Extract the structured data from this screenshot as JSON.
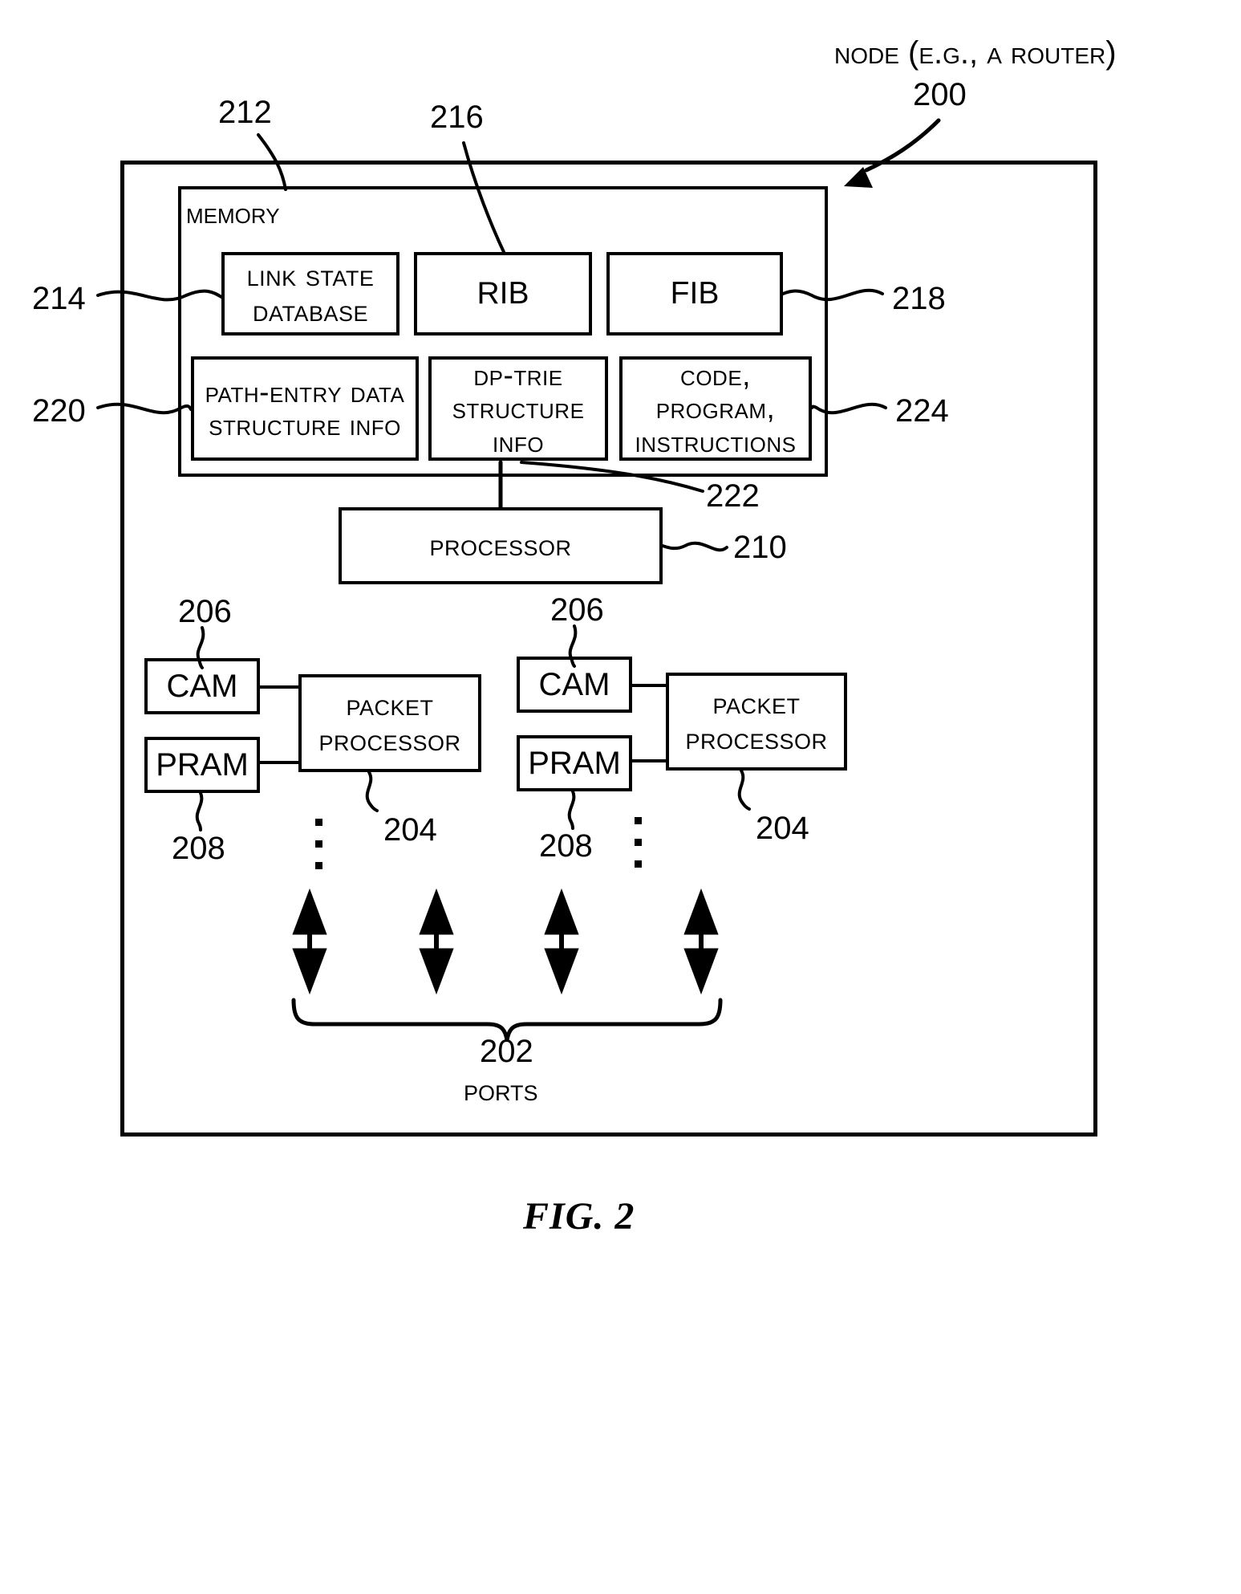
{
  "figure": {
    "label": "FIG. 2",
    "node_title": "Node (e.g., a Router)",
    "node_ref": "200"
  },
  "memory": {
    "label": "Memory",
    "ref": "212",
    "items": [
      {
        "label": "Link State Database",
        "ref": "214"
      },
      {
        "label": "RIB",
        "ref": "216"
      },
      {
        "label": "FIB",
        "ref": "218"
      },
      {
        "label": "Path-entry Data Structure Info",
        "ref": "220"
      },
      {
        "label": "DP-trie Structure Info",
        "ref": "222"
      },
      {
        "label": "Code, Program, Instructions",
        "ref": "224"
      }
    ]
  },
  "processor": {
    "label": "Processor",
    "ref": "210"
  },
  "line_cards": [
    {
      "cam": {
        "label": "CAM",
        "ref": "206"
      },
      "pram": {
        "label": "PRAM",
        "ref": "208"
      },
      "packet_processor": {
        "label": "Packet Processor",
        "ref": "204"
      }
    },
    {
      "cam": {
        "label": "CAM",
        "ref": "206"
      },
      "pram": {
        "label": "PRAM",
        "ref": "208"
      },
      "packet_processor": {
        "label": "Packet Processor",
        "ref": "204"
      }
    }
  ],
  "ports": {
    "ref": "202",
    "label": "Ports",
    "arrow_count": 4
  }
}
